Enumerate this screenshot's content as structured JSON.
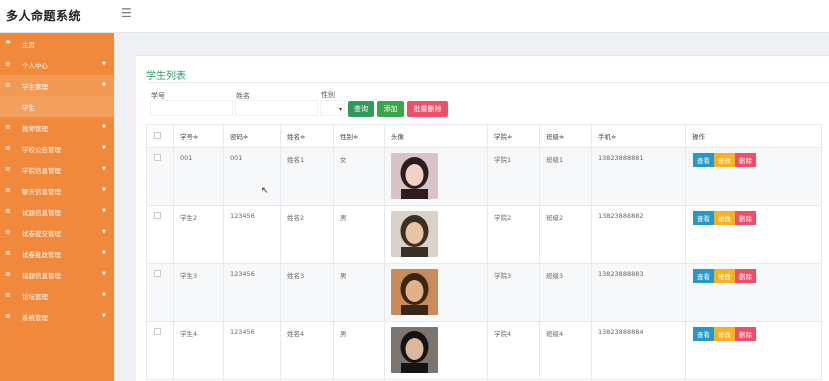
{
  "app": {
    "title": "多人命题系统",
    "menu_icon": "hamburger-icon"
  },
  "sidebar": {
    "items": [
      {
        "label": "主页",
        "icon": "flag-icon",
        "caret": false,
        "sub": false
      },
      {
        "label": "个人中心",
        "icon": "list-icon",
        "caret": true,
        "sub": false
      },
      {
        "label": "学生管理",
        "icon": "list-icon",
        "caret": true,
        "sub": false,
        "open": true
      },
      {
        "label": "学生",
        "icon": "",
        "caret": false,
        "sub": true
      },
      {
        "label": "教师管理",
        "icon": "list-icon",
        "caret": true,
        "sub": false
      },
      {
        "label": "学校公告管理",
        "icon": "list-icon",
        "caret": true,
        "sub": false
      },
      {
        "label": "学院信息管理",
        "icon": "list-icon",
        "caret": true,
        "sub": false
      },
      {
        "label": "聊天信息管理",
        "icon": "list-icon",
        "caret": true,
        "sub": false
      },
      {
        "label": "试题信息管理",
        "icon": "list-icon",
        "caret": true,
        "sub": false
      },
      {
        "label": "试卷提交管理",
        "icon": "list-icon",
        "caret": true,
        "sub": false
      },
      {
        "label": "试卷批改管理",
        "icon": "list-icon",
        "caret": true,
        "sub": false
      },
      {
        "label": "错题信息管理",
        "icon": "list-icon",
        "caret": true,
        "sub": false
      },
      {
        "label": "论坛管理",
        "icon": "list-icon",
        "caret": true,
        "sub": false
      },
      {
        "label": "系统管理",
        "icon": "list-icon",
        "caret": true,
        "sub": false
      }
    ]
  },
  "main": {
    "title": "学生列表",
    "filters": {
      "student_no_label": "学号",
      "name_label": "姓名",
      "gender_label": "性别",
      "student_no_value": "",
      "name_value": "",
      "gender_value": ""
    },
    "buttons": {
      "search": "查询",
      "add": "添加",
      "batch_delete": "批量删除"
    },
    "colors": {
      "sidebar": "#f0893b",
      "title": "#2e9c6a",
      "search": "#2f9a5f",
      "add": "#3aa64a",
      "batch_delete": "#ef4e6b",
      "view": "#2799c9",
      "edit": "#f4b322",
      "delete": "#ef4e6b"
    },
    "table": {
      "headers": [
        "学号≑",
        "密码≑",
        "姓名≑",
        "性别≑",
        "头像",
        "学院≑",
        "班级≑",
        "手机≑",
        "操作"
      ],
      "action_labels": {
        "view": "查看",
        "edit": "修改",
        "delete": "删除"
      },
      "rows": [
        {
          "student_no": "001",
          "password": "001",
          "name": "姓名1",
          "gender": "女",
          "avatar": "female-portrait",
          "college": "学院1",
          "class": "班级1",
          "phone": "13823888881"
        },
        {
          "student_no": "学生2",
          "password": "123456",
          "name": "姓名2",
          "gender": "男",
          "avatar": "male-portrait-glasses",
          "college": "学院2",
          "class": "班级2",
          "phone": "13823888882"
        },
        {
          "student_no": "学生3",
          "password": "123456",
          "name": "姓名3",
          "gender": "男",
          "avatar": "female-portrait-outdoor",
          "college": "学院3",
          "class": "班级3",
          "phone": "13823888883"
        },
        {
          "student_no": "学生4",
          "password": "123456",
          "name": "姓名4",
          "gender": "男",
          "avatar": "male-portrait-dark",
          "college": "学院4",
          "class": "班级4",
          "phone": "13823888884"
        }
      ]
    }
  }
}
